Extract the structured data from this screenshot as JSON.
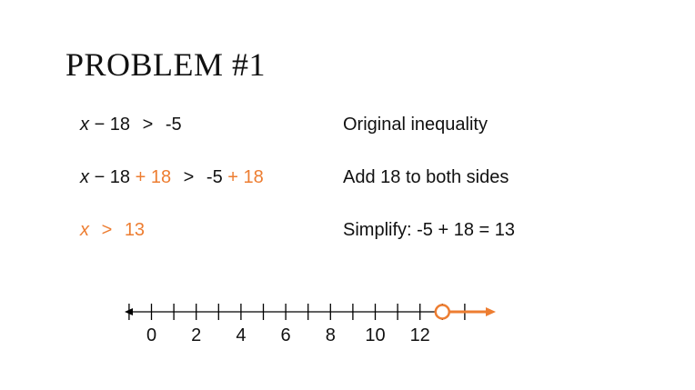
{
  "title": "PROBLEM #1",
  "accent_color": "#ED7D31",
  "steps": [
    {
      "math": {
        "var": "x",
        "lhs": "− 18",
        "add_left": "",
        "op": ">",
        "rhs": "-5",
        "add_right": ""
      },
      "note": "Original inequality",
      "highlight": false
    },
    {
      "math": {
        "var": "x",
        "lhs": "− 18",
        "add_left": "+ 18",
        "op": ">",
        "rhs": "-5",
        "add_right": "+ 18"
      },
      "note": "Add 18 to both sides",
      "highlight": false
    },
    {
      "math": {
        "var": "x",
        "lhs": "",
        "add_left": "",
        "op": ">",
        "rhs": "13",
        "add_right": ""
      },
      "note": "Simplify: -5 + 18 = 13",
      "highlight": true
    }
  ],
  "number_line": {
    "min": -1,
    "max": 14,
    "labels": [
      "0",
      "2",
      "4",
      "6",
      "8",
      "10",
      "12"
    ],
    "label_values": [
      0,
      2,
      4,
      6,
      8,
      10,
      12
    ],
    "solution": {
      "value": 13,
      "open_circle": true,
      "direction": "right"
    }
  }
}
